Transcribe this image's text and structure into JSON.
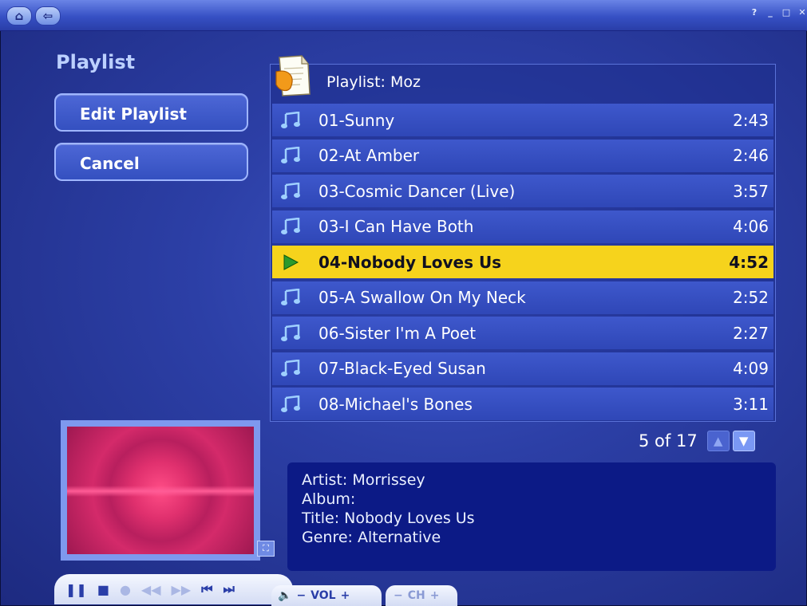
{
  "titlebar": {
    "home_icon": "home-icon",
    "back_icon": "back-arrow-icon",
    "help_label": "?",
    "minimize_label": "_",
    "maximize_label": "□",
    "close_label": "✕"
  },
  "sidebar": {
    "title": "Playlist",
    "edit_button": "Edit Playlist",
    "cancel_button": "Cancel"
  },
  "playlist": {
    "header": "Playlist: Moz",
    "selected_index": 4,
    "tracks": [
      {
        "name": "01-Sunny",
        "duration": "2:43"
      },
      {
        "name": "02-At Amber",
        "duration": "2:46"
      },
      {
        "name": "03-Cosmic Dancer (Live)",
        "duration": "3:57"
      },
      {
        "name": "03-I Can Have Both",
        "duration": "4:06"
      },
      {
        "name": "04-Nobody Loves Us",
        "duration": "4:52"
      },
      {
        "name": "05-A Swallow On My Neck",
        "duration": "2:52"
      },
      {
        "name": "06-Sister I'm A Poet",
        "duration": "2:27"
      },
      {
        "name": "07-Black-Eyed Susan",
        "duration": "4:09"
      },
      {
        "name": "08-Michael's Bones",
        "duration": "3:11"
      }
    ],
    "pager_text": "5 of 17"
  },
  "info": {
    "artist": "Artist: Morrissey",
    "album": "Album:",
    "title": "Title: Nobody Loves Us",
    "genre": "Genre: Alternative"
  },
  "transport": {
    "vol_label": "VOL",
    "ch_label": "CH"
  },
  "colors": {
    "selected_row": "#f6d31c",
    "row": "#3450c0",
    "info_bg": "#0c1a86"
  }
}
